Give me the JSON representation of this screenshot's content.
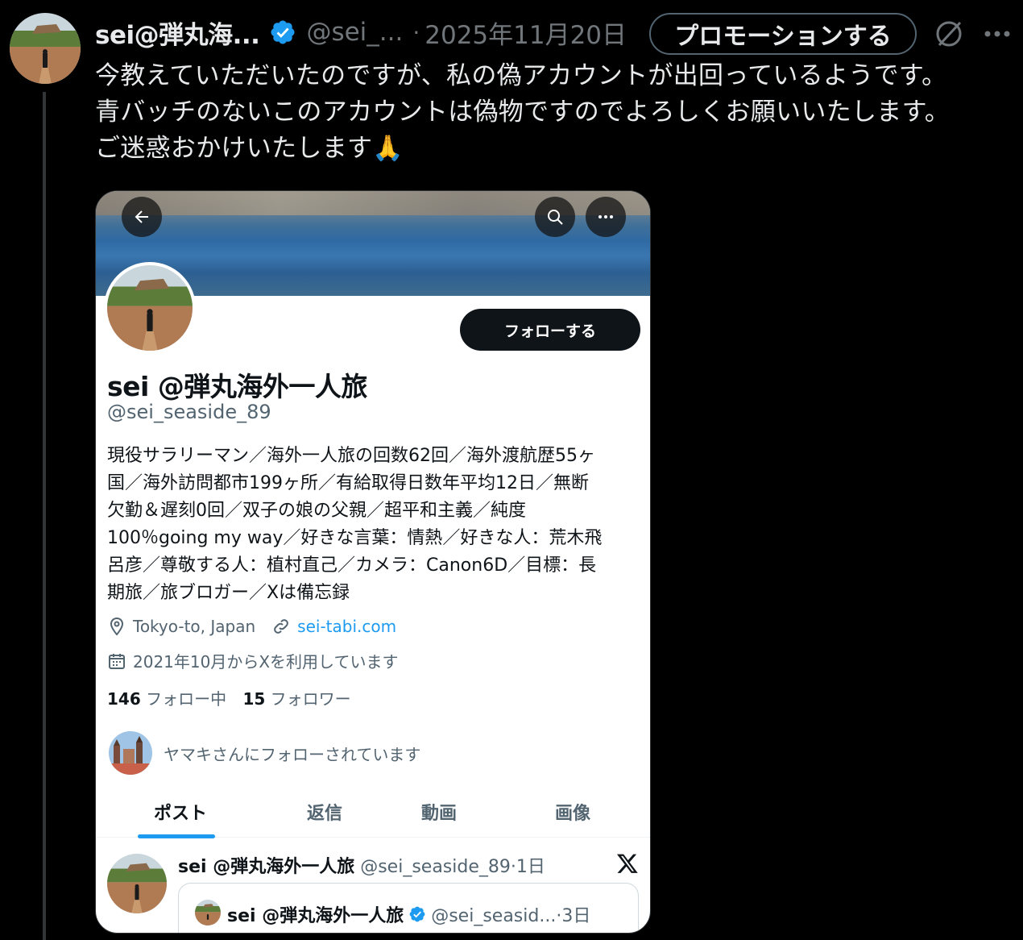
{
  "tweet": {
    "author_name": "sei@弾丸海...",
    "author_handle": "@sei_...",
    "separator": "·",
    "date": "2025年11月20日",
    "promote_label": "プロモーションする",
    "text_lines": [
      "今教えていただいたのですが、私の偽アカウントが出回っているようです。",
      "青バッチのないこのアカウントは偽物ですのでよろしくお願いいたします。",
      "ご迷惑おかけいたします"
    ],
    "emoji": "🙏"
  },
  "screenshot": {
    "follow_label": "フォローする",
    "name": "sei @弾丸海外一人旅",
    "handle": "@sei_seaside_89",
    "bio_lines": [
      "現役サラリーマン／海外一人旅の回数62回／海外渡航歴55ヶ",
      "国／海外訪問都市199ヶ所／有給取得日数年平均12日／無断",
      "欠勤＆遅刻0回／双子の娘の父親／超平和主義／純度",
      "100％going my way／好きな言葉：情熱／好きな人：荒木飛",
      "呂彦／尊敬する人：植村直己／カメラ：Canon6D／目標：長",
      "期旅／旅ブロガー／Xは備忘録"
    ],
    "location": "Tokyo-to, Japan",
    "website": "sei-tabi.com",
    "joined": "2021年10月からXを利用しています",
    "following_count": "146",
    "following_label": "フォロー中",
    "followers_count": "15",
    "followers_label": "フォロワー",
    "followed_by": "ヤマキさんにフォローされています",
    "tabs": [
      "ポスト",
      "返信",
      "動画",
      "画像"
    ],
    "post": {
      "name": "sei @弾丸海外一人旅",
      "handle_time": "@sei_seaside_89·1日"
    },
    "quote": {
      "name": "sei @弾丸海外一人旅",
      "handle_time": "@sei_seasid...·3日"
    }
  },
  "colors": {
    "background": "#000000",
    "verified_blue": "#1d9bf0",
    "link_blue": "#1d9bf0",
    "muted_text": "#71767b"
  },
  "icons": [
    "verified-badge-icon",
    "grok-icon",
    "more-icon",
    "back-arrow-icon",
    "search-icon",
    "location-icon",
    "link-icon",
    "calendar-icon",
    "x-logo-icon"
  ]
}
